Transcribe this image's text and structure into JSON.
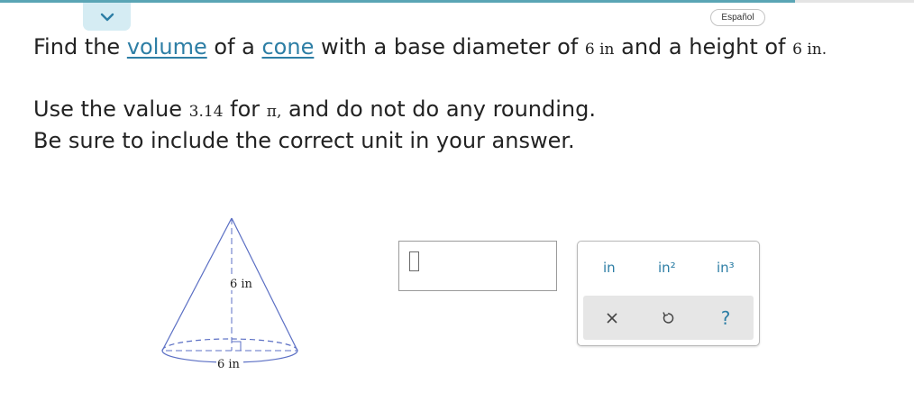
{
  "header": {
    "collapse_icon": "chevron-down-icon",
    "language_label": "Español"
  },
  "question": {
    "line1": {
      "p1": "Find the ",
      "link1": "volume",
      "p2": " of a ",
      "link2": "cone",
      "p3": " with a base diameter of ",
      "diameter": "6 in",
      "p4": " and a height of ",
      "height": "6 in."
    },
    "line2": {
      "p1": "Use the value ",
      "pi_value": "3.14",
      "p2": " for ",
      "pi_symbol": "π,",
      "p3": " and do not do any rounding."
    },
    "line3": "Be sure to include the correct unit in your answer."
  },
  "figure": {
    "height_label": "6 in",
    "diameter_label": "6 in"
  },
  "answer": {
    "value": ""
  },
  "keypad": {
    "units": [
      "in",
      "in²",
      "in³"
    ],
    "actions": {
      "clear_icon": "close-icon",
      "undo_icon": "undo-icon",
      "help_label": "?"
    }
  },
  "colors": {
    "accent": "#2d7ea5",
    "top_bar": "#5aa5b5",
    "collapse_bg": "#d5ecf3",
    "cone_stroke": "#5b6fc4"
  }
}
